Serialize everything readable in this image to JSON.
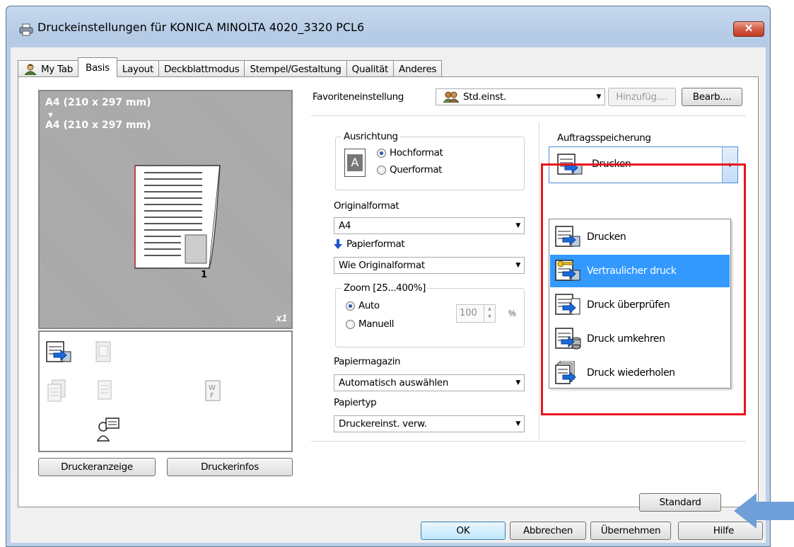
{
  "window": {
    "title": "Druckeinstellungen für KONICA MINOLTA 4020_3320 PCL6",
    "close_label": "✕"
  },
  "tabs": [
    {
      "label": "My Tab"
    },
    {
      "label": "Basis"
    },
    {
      "label": "Layout"
    },
    {
      "label": "Deckblattmodus"
    },
    {
      "label": "Stempel/Gestaltung"
    },
    {
      "label": "Qualität"
    },
    {
      "label": "Anderes"
    }
  ],
  "active_tab": "Basis",
  "preview": {
    "format_top": "A4 (210 x 297 mm)",
    "arrow": "▼",
    "format_bottom": "A4 (210 x 297 mm)",
    "copies": "x1",
    "page_number": "1"
  },
  "left_buttons": {
    "printer_view": "Druckeranzeige",
    "printer_info": "Druckerinfos"
  },
  "favorites": {
    "label": "Favoriteneinstellung",
    "value": "Std.einst.",
    "add_button": "Hinzufüg....",
    "edit_button": "Bearb...."
  },
  "orientation": {
    "title": "Ausrichtung",
    "icon_letter": "A",
    "options": [
      "Hochformat",
      "Querformat"
    ],
    "selected": "Hochformat"
  },
  "original_format": {
    "label": "Originalformat",
    "value": "A4"
  },
  "paper_format": {
    "label": "Papierformat",
    "value": "Wie Originalformat"
  },
  "zoom": {
    "title": "Zoom [25...400%]",
    "options": [
      "Auto",
      "Manuell"
    ],
    "selected": "Auto",
    "value": "100",
    "unit": "%"
  },
  "paper_tray": {
    "label": "Papiermagazin",
    "value": "Automatisch auswählen"
  },
  "paper_type": {
    "label": "Papiertyp",
    "value": "Druckereinst. verw."
  },
  "job_storage": {
    "label": "Auftragsspeicherung",
    "value": "Drucken",
    "options": [
      "Drucken",
      "Vertraulicher druck",
      "Druck überprüfen",
      "Druck umkehren",
      "Druck wiederholen"
    ],
    "highlighted": "Vertraulicher druck"
  },
  "standard_button": "Standard",
  "footer": {
    "ok": "OK",
    "cancel": "Abbrechen",
    "apply": "Übernehmen",
    "help": "Hilfe"
  },
  "colors": {
    "selection": "#3399ff",
    "highlight_border": "#e8141c",
    "callout_arrow": "#6f9fd8"
  }
}
